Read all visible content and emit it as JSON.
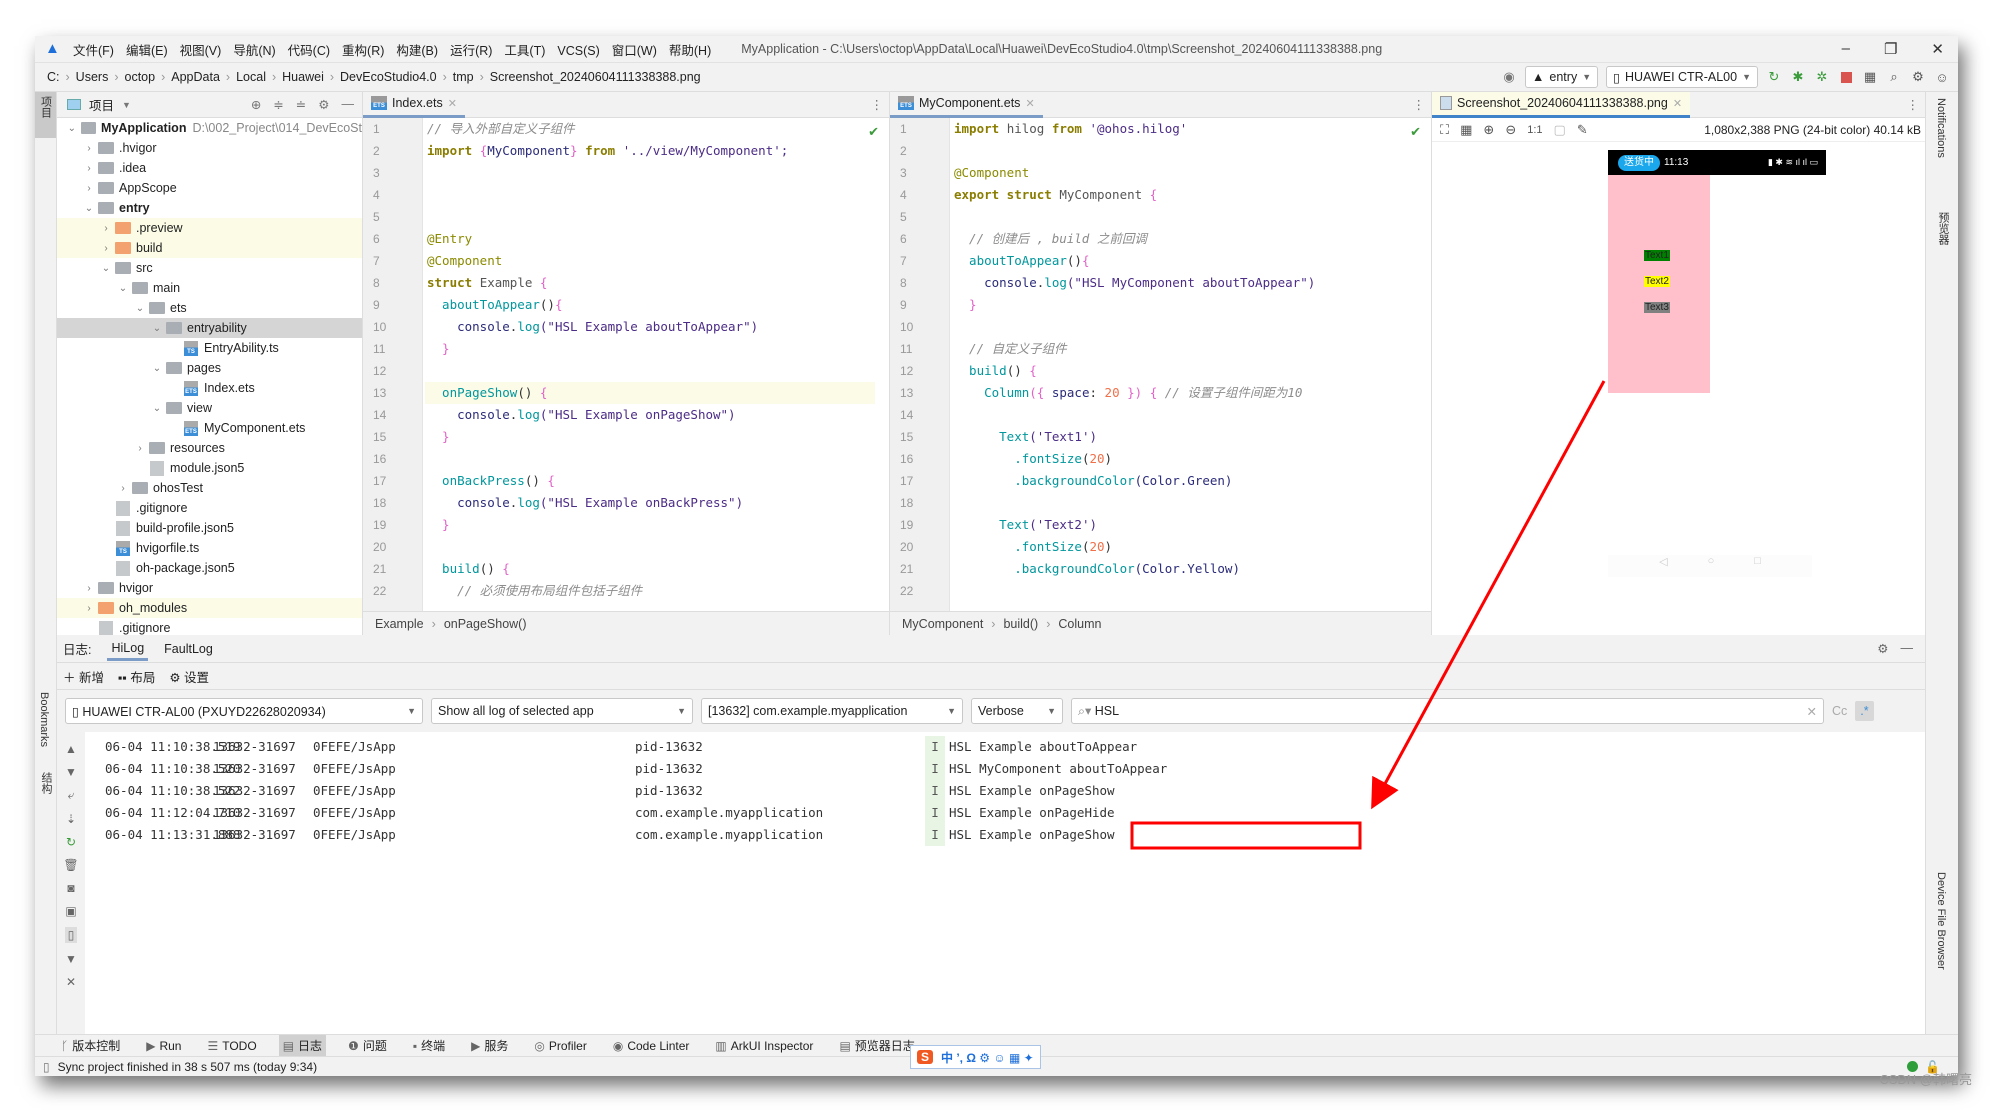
{
  "titlebar": {
    "menus": [
      "文件(F)",
      "编辑(E)",
      "视图(V)",
      "导航(N)",
      "代码(C)",
      "重构(R)",
      "构建(B)",
      "运行(R)",
      "工具(T)",
      "VCS(S)",
      "窗口(W)",
      "帮助(H)"
    ],
    "title": "MyApplication - C:\\Users\\octop\\AppData\\Local\\Huawei\\DevEcoStudio4.0\\tmp\\Screenshot_20240604111338388.png"
  },
  "navbar": {
    "crumbs": [
      "C:",
      "Users",
      "octop",
      "AppData",
      "Local",
      "Huawei",
      "DevEcoStudio4.0",
      "tmp",
      "Screenshot_20240604111338388.png"
    ],
    "run_config": "entry",
    "device": "HUAWEI CTR-AL00"
  },
  "project": {
    "title": "项目",
    "side_label": "项目",
    "tree": [
      {
        "label": "MyApplication",
        "extra": "D:\\002_Project\\014_DevEcoSt",
        "depth": 0,
        "arrow": "open",
        "icon": "module",
        "bold": true
      },
      {
        "label": ".hvigor",
        "depth": 1,
        "arrow": "closed",
        "icon": "folder"
      },
      {
        "label": ".idea",
        "depth": 1,
        "arrow": "closed",
        "icon": "folder"
      },
      {
        "label": "AppScope",
        "depth": 1,
        "arrow": "closed",
        "icon": "folder"
      },
      {
        "label": "entry",
        "depth": 1,
        "arrow": "open",
        "icon": "module",
        "bold": true
      },
      {
        "label": ".preview",
        "depth": 2,
        "arrow": "closed",
        "icon": "folder-orange",
        "hl": true
      },
      {
        "label": "build",
        "depth": 2,
        "arrow": "closed",
        "icon": "folder-orange",
        "hl": true
      },
      {
        "label": "src",
        "depth": 2,
        "arrow": "open",
        "icon": "folder"
      },
      {
        "label": "main",
        "depth": 3,
        "arrow": "open",
        "icon": "folder"
      },
      {
        "label": "ets",
        "depth": 4,
        "arrow": "open",
        "icon": "folder"
      },
      {
        "label": "entryability",
        "depth": 5,
        "arrow": "open",
        "icon": "folder",
        "sel": true
      },
      {
        "label": "EntryAbility.ts",
        "depth": 6,
        "arrow": "",
        "icon": "ts"
      },
      {
        "label": "pages",
        "depth": 5,
        "arrow": "open",
        "icon": "folder"
      },
      {
        "label": "Index.ets",
        "depth": 6,
        "arrow": "",
        "icon": "ets"
      },
      {
        "label": "view",
        "depth": 5,
        "arrow": "open",
        "icon": "folder"
      },
      {
        "label": "MyComponent.ets",
        "depth": 6,
        "arrow": "",
        "icon": "ets"
      },
      {
        "label": "resources",
        "depth": 4,
        "arrow": "closed",
        "icon": "folder"
      },
      {
        "label": "module.json5",
        "depth": 4,
        "arrow": "",
        "icon": "json"
      },
      {
        "label": "ohosTest",
        "depth": 3,
        "arrow": "closed",
        "icon": "folder"
      },
      {
        "label": ".gitignore",
        "depth": 2,
        "arrow": "",
        "icon": "file"
      },
      {
        "label": "build-profile.json5",
        "depth": 2,
        "arrow": "",
        "icon": "json"
      },
      {
        "label": "hvigorfile.ts",
        "depth": 2,
        "arrow": "",
        "icon": "ts"
      },
      {
        "label": "oh-package.json5",
        "depth": 2,
        "arrow": "",
        "icon": "json"
      },
      {
        "label": "hvigor",
        "depth": 1,
        "arrow": "closed",
        "icon": "folder"
      },
      {
        "label": "oh_modules",
        "depth": 1,
        "arrow": "closed",
        "icon": "folder-orange",
        "hl": true
      },
      {
        "label": ".gitignore",
        "depth": 1,
        "arrow": "",
        "icon": "file"
      }
    ]
  },
  "editor1": {
    "tab": "Index.ets",
    "current_line": 13,
    "breadcrumb": [
      "Example",
      "onPageShow()"
    ],
    "lines": [
      [
        [
          "// 导入外部自定义子组件",
          "cm"
        ]
      ],
      [
        [
          "import ",
          "kw"
        ],
        [
          "{",
          "br"
        ],
        [
          "MyComponent",
          "id"
        ],
        [
          "}",
          "br"
        ],
        [
          " from ",
          "kw"
        ],
        [
          "'../view/MyComponent';",
          "st"
        ]
      ],
      [],
      [],
      [],
      [
        [
          "@Entry",
          "an"
        ]
      ],
      [
        [
          "@Component",
          "an"
        ]
      ],
      [
        [
          "struct ",
          "kw"
        ],
        [
          "Example ",
          "ty"
        ],
        [
          "{",
          "br"
        ]
      ],
      [
        [
          "  aboutToAppear",
          "fn"
        ],
        [
          "()",
          "pl"
        ],
        [
          "{",
          "br"
        ]
      ],
      [
        [
          "    console",
          "id"
        ],
        [
          ".",
          "pl"
        ],
        [
          "log",
          "fn"
        ],
        [
          "(\"HSL Example aboutToAppear\")",
          "st"
        ]
      ],
      [
        [
          "  }",
          "br"
        ]
      ],
      [],
      [
        [
          "  onPageShow",
          "fn"
        ],
        [
          "() ",
          "pl"
        ],
        [
          "{",
          "br"
        ]
      ],
      [
        [
          "    console",
          "id"
        ],
        [
          ".",
          "pl"
        ],
        [
          "log",
          "fn"
        ],
        [
          "(\"HSL Example onPageShow\")",
          "st"
        ]
      ],
      [
        [
          "  }",
          "br"
        ]
      ],
      [],
      [
        [
          "  onBackPress",
          "fn"
        ],
        [
          "() ",
          "pl"
        ],
        [
          "{",
          "br"
        ]
      ],
      [
        [
          "    console",
          "id"
        ],
        [
          ".",
          "pl"
        ],
        [
          "log",
          "fn"
        ],
        [
          "(\"HSL Example onBackPress\")",
          "st"
        ]
      ],
      [
        [
          "  }",
          "br"
        ]
      ],
      [],
      [
        [
          "  build",
          "fn"
        ],
        [
          "() ",
          "pl"
        ],
        [
          "{",
          "br"
        ]
      ],
      [
        [
          "    // 必须使用布局组件包括子组件",
          "cm"
        ]
      ]
    ]
  },
  "editor2": {
    "tab": "MyComponent.ets",
    "breadcrumb": [
      "MyComponent",
      "build()",
      "Column"
    ],
    "lines": [
      [
        [
          "import ",
          "kw"
        ],
        [
          "hilog ",
          "ty"
        ],
        [
          "from ",
          "kw"
        ],
        [
          "'@ohos.hilog'",
          "st"
        ]
      ],
      [],
      [
        [
          "@Component",
          "an"
        ]
      ],
      [
        [
          "export struct ",
          "kw"
        ],
        [
          "MyComponent ",
          "ty"
        ],
        [
          "{",
          "br"
        ]
      ],
      [],
      [
        [
          "  // 创建后 , build 之前回调",
          "cm"
        ]
      ],
      [
        [
          "  aboutToAppear",
          "fn"
        ],
        [
          "()",
          "pl"
        ],
        [
          "{",
          "br"
        ]
      ],
      [
        [
          "    console",
          "id"
        ],
        [
          ".",
          "pl"
        ],
        [
          "log",
          "fn"
        ],
        [
          "(\"HSL MyComponent aboutToAppear\")",
          "st"
        ]
      ],
      [
        [
          "  }",
          "br"
        ]
      ],
      [],
      [
        [
          "  // 自定义子组件",
          "cm"
        ]
      ],
      [
        [
          "  build",
          "fn"
        ],
        [
          "() ",
          "pl"
        ],
        [
          "{",
          "br"
        ]
      ],
      [
        [
          "    Column",
          "fn"
        ],
        [
          "({ ",
          "br"
        ],
        [
          "space",
          "id"
        ],
        [
          ": ",
          "pl"
        ],
        [
          "20",
          "nm"
        ],
        [
          " }) { ",
          "br"
        ],
        [
          "// 设置子组件间距为10",
          "cm"
        ]
      ],
      [],
      [
        [
          "      Text",
          "fn"
        ],
        [
          "('Text1')",
          "st"
        ]
      ],
      [
        [
          "        .fontSize",
          "fn"
        ],
        [
          "(",
          "pl"
        ],
        [
          "20",
          "nm"
        ],
        [
          ")",
          "pl"
        ]
      ],
      [
        [
          "        .backgroundColor",
          "fn"
        ],
        [
          "(Color.Green)",
          "id"
        ]
      ],
      [],
      [
        [
          "      Text",
          "fn"
        ],
        [
          "('Text2')",
          "st"
        ]
      ],
      [
        [
          "        .fontSize",
          "fn"
        ],
        [
          "(",
          "pl"
        ],
        [
          "20",
          "nm"
        ],
        [
          ")",
          "pl"
        ]
      ],
      [
        [
          "        .backgroundColor",
          "fn"
        ],
        [
          "(Color.Yellow)",
          "id"
        ]
      ],
      []
    ]
  },
  "viewer": {
    "tab": "Screenshot_20240604111338388.png",
    "info": "1,080x2,388 PNG (24-bit color) 40.14 kB",
    "zoom_label": "1:1",
    "phone": {
      "pill": "送货中",
      "time": "11:13",
      "texts": [
        "Text1",
        "Text2",
        "Text3"
      ],
      "colors": [
        "#008000",
        "#ffff00",
        "#808080"
      ],
      "bg": "#ffc0cb"
    }
  },
  "log": {
    "label": "日志:",
    "tabs": [
      "HiLog",
      "FaultLog"
    ],
    "toolbar": [
      "新增",
      "布局",
      "设置"
    ],
    "device": "HUAWEI CTR-AL00 (PXUYD22628020934)",
    "scope": "Show all log of selected app",
    "process": "[13632] com.example.myapplication",
    "level": "Verbose",
    "search": "HSL",
    "case_label": "Cc",
    "rows": [
      {
        "time": "06-04 11:10:38.519",
        "pid": "13632-31697",
        "tag": "0FEFE/JsApp",
        "proc": "pid-13632",
        "lvl": "I",
        "msg": "HSL Example aboutToAppear"
      },
      {
        "time": "06-04 11:10:38.520",
        "pid": "13632-31697",
        "tag": "0FEFE/JsApp",
        "proc": "pid-13632",
        "lvl": "I",
        "msg": "HSL MyComponent aboutToAppear"
      },
      {
        "time": "06-04 11:10:38.522",
        "pid": "13632-31697",
        "tag": "0FEFE/JsApp",
        "proc": "pid-13632",
        "lvl": "I",
        "msg": "HSL Example onPageShow"
      },
      {
        "time": "06-04 11:12:04.710",
        "pid": "13632-31697",
        "tag": "0FEFE/JsApp",
        "proc": "com.example.myapplication",
        "lvl": "I",
        "msg": "HSL Example onPageHide"
      },
      {
        "time": "06-04 11:13:31.888",
        "pid": "13632-31697",
        "tag": "0FEFE/JsApp",
        "proc": "com.example.myapplication",
        "lvl": "I",
        "msg": "HSL Example onPageShow"
      }
    ]
  },
  "bottom_tabs": [
    "版本控制",
    "Run",
    "TODO",
    "日志",
    "问题",
    "终端",
    "服务",
    "Profiler",
    "Code Linter",
    "ArkUI Inspector",
    "预览器日志"
  ],
  "active_bottom_tab": "日志",
  "side_labels": {
    "bookmarks": "Bookmarks",
    "structure": "结构",
    "notifications": "Notifications",
    "previewer": "预览器",
    "device_files": "Device File Browser"
  },
  "status": "Sync project finished in 38 s 507 ms (today 9:34)",
  "watermark": "CSDN @韩曙亮",
  "annotation_color": "#ff0000"
}
